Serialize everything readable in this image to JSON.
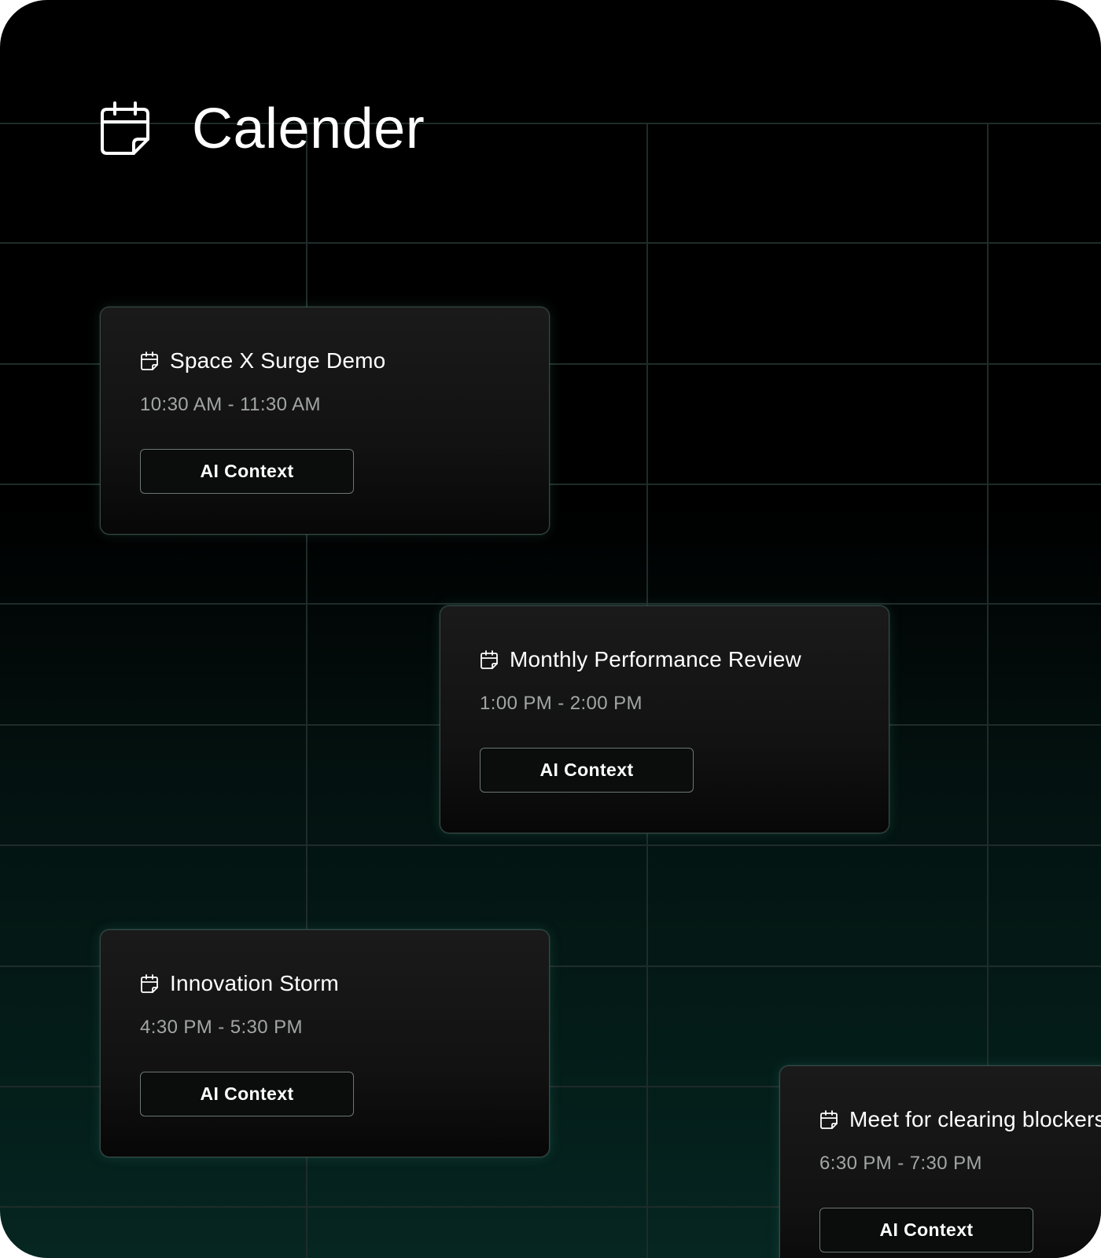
{
  "header": {
    "title": "Calender",
    "icon": "calendar-icon"
  },
  "colors": {
    "background_top": "#000000",
    "background_bottom": "#062621",
    "grid_line": "#1f2c29",
    "card_border": "#3a4a45",
    "text_primary": "#ffffff",
    "text_secondary": "#a3a6a6"
  },
  "events": [
    {
      "title": "Space X Surge Demo",
      "time": "10:30 AM - 11:30 AM",
      "button_label": "AI Context",
      "icon": "calendar-icon"
    },
    {
      "title": "Monthly Performance Review",
      "time": "1:00 PM - 2:00 PM",
      "button_label": "AI Context",
      "icon": "calendar-icon"
    },
    {
      "title": "Innovation Storm",
      "time": "4:30 PM - 5:30 PM",
      "button_label": "AI Context",
      "icon": "calendar-icon"
    },
    {
      "title": "Meet for clearing blockers",
      "time": "6:30 PM - 7:30 PM",
      "button_label": "AI Context",
      "icon": "calendar-icon"
    }
  ]
}
